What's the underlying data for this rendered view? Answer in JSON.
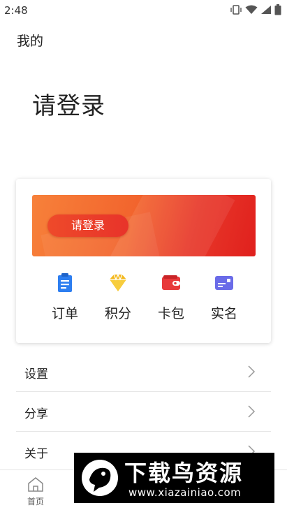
{
  "status_bar": {
    "time": "2:48"
  },
  "header": {
    "title": "我的"
  },
  "login": {
    "title": "请登录"
  },
  "banner": {
    "button_label": "请登录"
  },
  "shortcuts": [
    {
      "label": "订单",
      "icon": "clipboard-icon",
      "color": "#2d7ef0"
    },
    {
      "label": "积分",
      "icon": "diamond-icon",
      "color": "#f4b81c"
    },
    {
      "label": "卡包",
      "icon": "wallet-icon",
      "color": "#e8393a"
    },
    {
      "label": "实名",
      "icon": "id-card-icon",
      "color": "#6a6be8"
    }
  ],
  "menu": [
    {
      "label": "设置"
    },
    {
      "label": "分享"
    },
    {
      "label": "关于"
    }
  ],
  "tabbar": [
    {
      "label": "首页",
      "icon": "home-icon"
    }
  ],
  "watermark": {
    "title": "下载鸟资源",
    "url": "www.xiazainiao.com"
  },
  "colors": {
    "accent": "#e8392a",
    "banner_start": "#f7813a",
    "banner_end": "#e0201d"
  }
}
